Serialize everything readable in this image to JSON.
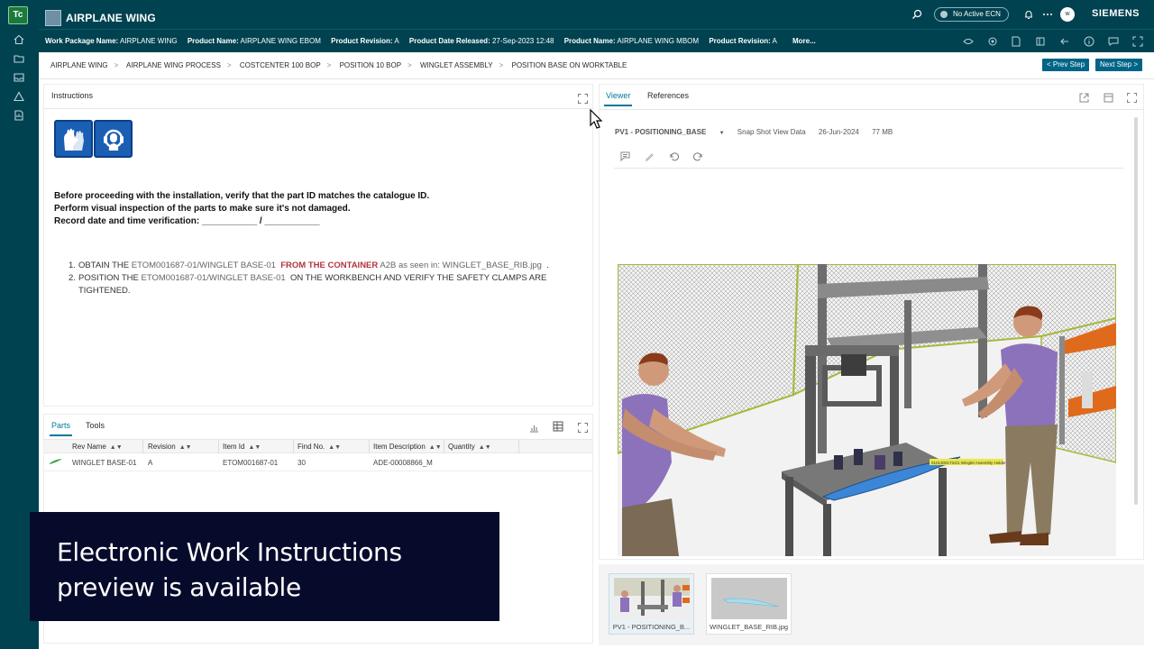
{
  "app": {
    "logo_text": "Tc",
    "title": "AIRPLANE WING",
    "brand": "SIEMENS",
    "ecn_label": "No Active ECN",
    "user_initial": "w"
  },
  "properties": [
    {
      "label": "Work Package Name:",
      "value": "AIRPLANE WING"
    },
    {
      "label": "Product Name:",
      "value": "AIRPLANE WING EBOM"
    },
    {
      "label": "Product Revision:",
      "value": "A"
    },
    {
      "label": "Product Date Released:",
      "value": "27-Sep-2023 12:48"
    },
    {
      "label": "Product Name:",
      "value": "AIRPLANE WING MBOM"
    },
    {
      "label": "Product Revision:",
      "value": "A"
    }
  ],
  "more_label": "More...",
  "breadcrumb": [
    "AIRPLANE WING",
    "AIRPLANE WING PROCESS",
    "COSTCENTER 100 BOP",
    "POSITION 10 BOP",
    "WINGLET ASSEMBLY",
    "POSITION BASE ON WORKTABLE"
  ],
  "nav": {
    "prev": "< Prev Step",
    "next": "Next Step >"
  },
  "instructions": {
    "title": "Instructions",
    "lines": [
      "Before proceeding with the installation, verify that the part ID matches the catalogue ID.",
      "Perform visual inspection of the parts to make sure it's not damaged.",
      "Record date and time verification:  ___________ / ___________"
    ],
    "step1": {
      "num": "1.",
      "a": "OBTAIN THE",
      "part": "ETOM001687-01/WINGLET BASE-01",
      "b": "FROM THE CONTAINER",
      "c": "A2B as seen in:",
      "file": "WINGLET_BASE_RIB.jpg",
      "d": "."
    },
    "step2": {
      "num": "2.",
      "a": "POSITION THE",
      "part": "ETOM001687-01/WINGLET BASE-01",
      "b": "ON THE WORKBENCH AND VERIFY THE SAFETY CLAMPS ARE TIGHTENED."
    }
  },
  "parts": {
    "tabs": [
      "Parts",
      "Tools"
    ],
    "columns": [
      "Rev Name",
      "Revision",
      "Item Id",
      "Find No.",
      "Item Description",
      "Quantity"
    ],
    "rows": [
      {
        "rev_name": "WINGLET BASE-01",
        "revision": "A",
        "item_id": "ETOM001687-01",
        "find_no": "30",
        "description": "ADE-00008866_M",
        "quantity": ""
      }
    ]
  },
  "viewer": {
    "tabs": [
      "Viewer",
      "References"
    ],
    "product_view": "PV1 - POSITIONING_BASE",
    "snapshot_label": "Snap Shot View Data",
    "date": "26-Jun-2024",
    "size": "77 MB",
    "scene_label": "01013001T24/1 Winglet Assembly Holder",
    "thumbnails": [
      "PV1 - POSITIONING_B...",
      "WINGLET_BASE_RIB.jpg"
    ]
  },
  "overlay": {
    "line1": "Electronic Work Instructions",
    "line2": "preview is available"
  },
  "colors": {
    "header": "#004250",
    "accent": "#007a99",
    "nav_button": "#006487",
    "overlay": "#060b2c",
    "highlight_red": "#b0353e"
  }
}
